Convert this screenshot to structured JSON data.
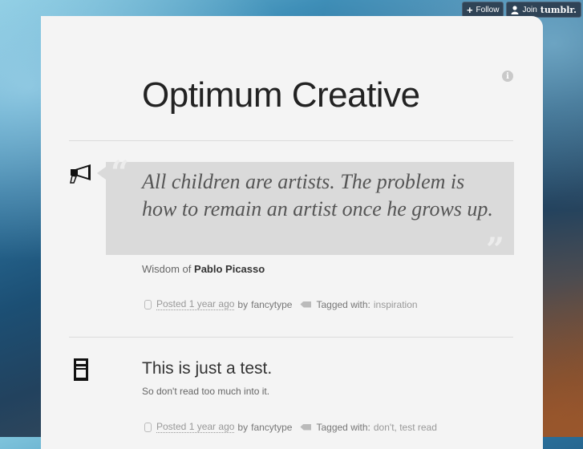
{
  "topbar": {
    "follow_label": "Follow",
    "join_label": "Join",
    "join_brand": "tumblr."
  },
  "blog": {
    "title": "Optimum Creative",
    "info_glyph": "i"
  },
  "quote_post": {
    "open_mark": "“",
    "close_mark": "”",
    "text": "All children are artists. The problem is how to remain an artist once he grows up.",
    "source_prefix": "Wisdom of",
    "source_name": "Pablo Picasso",
    "meta": {
      "posted": "Posted",
      "when": "1 year ago",
      "by": "by",
      "author": "fancytype",
      "tagged": "Tagged with:",
      "tags": "inspiration"
    }
  },
  "text_post": {
    "title": "This is just a test.",
    "body": "So don't read too much into it.",
    "meta": {
      "posted": "Posted",
      "when": "1 year ago",
      "by": "by",
      "author": "fancytype",
      "tagged": "Tagged with:",
      "tags": "don't,  test read"
    }
  }
}
